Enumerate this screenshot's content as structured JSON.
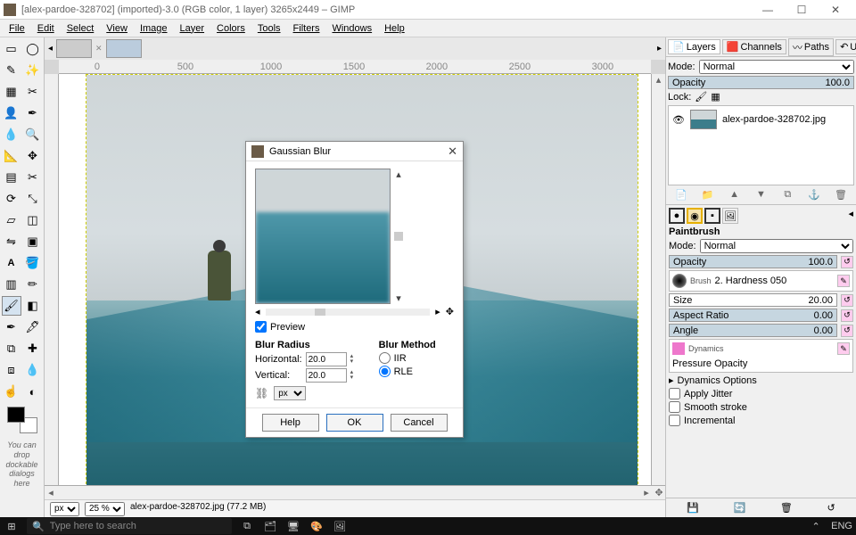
{
  "titlebar": {
    "title": "[alex-pardoe-328702] (imported)-3.0 (RGB color, 1 layer) 3265x2449 – GIMP"
  },
  "window_controls": {
    "min": "—",
    "max": "☐",
    "close": "✕"
  },
  "menus": [
    "File",
    "Edit",
    "Select",
    "View",
    "Image",
    "Layer",
    "Colors",
    "Tools",
    "Filters",
    "Windows",
    "Help"
  ],
  "ruler_marks": [
    "0",
    "500",
    "1000",
    "1500",
    "2000",
    "2500",
    "3000"
  ],
  "statusbar": {
    "unit": "px",
    "zoom": "25 %",
    "info": "alex-pardoe-328702.jpg (77.2 MB)"
  },
  "dock": {
    "tabs": [
      {
        "icon": "📄",
        "label": "Layers"
      },
      {
        "icon": "🟥",
        "label": "Channels"
      },
      {
        "icon": "〰",
        "label": "Paths"
      },
      {
        "icon": "↶",
        "label": "Undo"
      }
    ],
    "mode_label": "Mode:",
    "mode_value": "Normal",
    "opacity_label": "Opacity",
    "opacity_value": "100.0",
    "lock_label": "Lock:",
    "layer_name": "alex-pardoe-328702.jpg"
  },
  "brush": {
    "title": "Paintbrush",
    "mode_label": "Mode:",
    "mode_value": "Normal",
    "opacity_label": "Opacity",
    "opacity_value": "100.0",
    "brush_label": "Brush",
    "brush_name": "2. Hardness 050",
    "size_label": "Size",
    "size_value": "20.00",
    "aspect_label": "Aspect Ratio",
    "aspect_value": "0.00",
    "angle_label": "Angle",
    "angle_value": "0.00",
    "dyn_label": "Dynamics",
    "dyn_value": "Pressure Opacity",
    "dyn_options": "Dynamics Options",
    "jitter": "Apply Jitter",
    "smooth": "Smooth stroke",
    "incremental": "Incremental"
  },
  "toolbox_hint": "You can drop dockable dialogs here",
  "dialog": {
    "title": "Gaussian Blur",
    "preview_label": "Preview",
    "radius_label": "Blur Radius",
    "horiz_label": "Horizontal:",
    "horiz_value": "20.0",
    "vert_label": "Vertical:",
    "vert_value": "20.0",
    "unit": "px",
    "method_label": "Blur Method",
    "method_iir": "IIR",
    "method_rle": "RLE",
    "help": "Help",
    "ok": "OK",
    "cancel": "Cancel"
  },
  "taskbar": {
    "search_placeholder": "Type here to search",
    "lang": "ENG"
  }
}
